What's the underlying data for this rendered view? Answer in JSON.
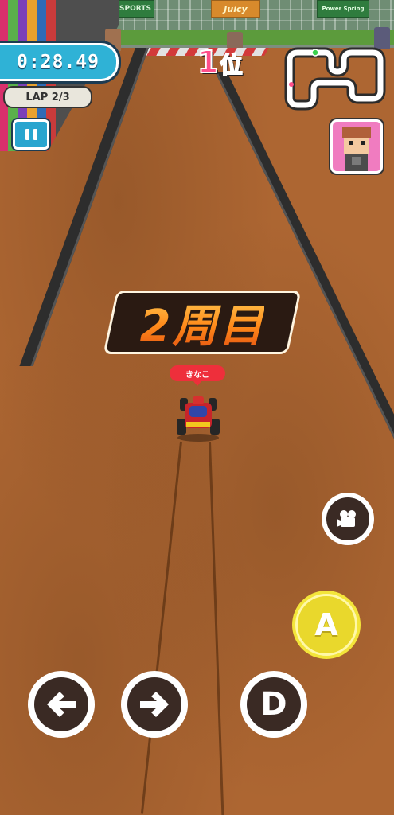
{
  "hud": {
    "timer": "0:28.49",
    "lap": "LAP 2/3",
    "position_number": "1",
    "position_unit": "位",
    "lap_announcement": "2周目",
    "player_name": "きなこ"
  },
  "banners": {
    "sports": "SPORTS",
    "juicy": "Juicy",
    "power_spring": "Power Spring"
  },
  "controls": {
    "left_icon": "arrow-left-icon",
    "right_icon": "arrow-right-icon",
    "drift_label": "D",
    "accel_label": "A",
    "camera_icon": "video-camera-icon",
    "pause_icon": "pause-icon"
  },
  "colors": {
    "timer_bg": "#2fb2d6",
    "position_pink": "#ff4f8b",
    "lap_banner_orange": "#ff8a1a",
    "accel_yellow": "#f3e53a",
    "name_tag_red": "#ee2f3b"
  }
}
